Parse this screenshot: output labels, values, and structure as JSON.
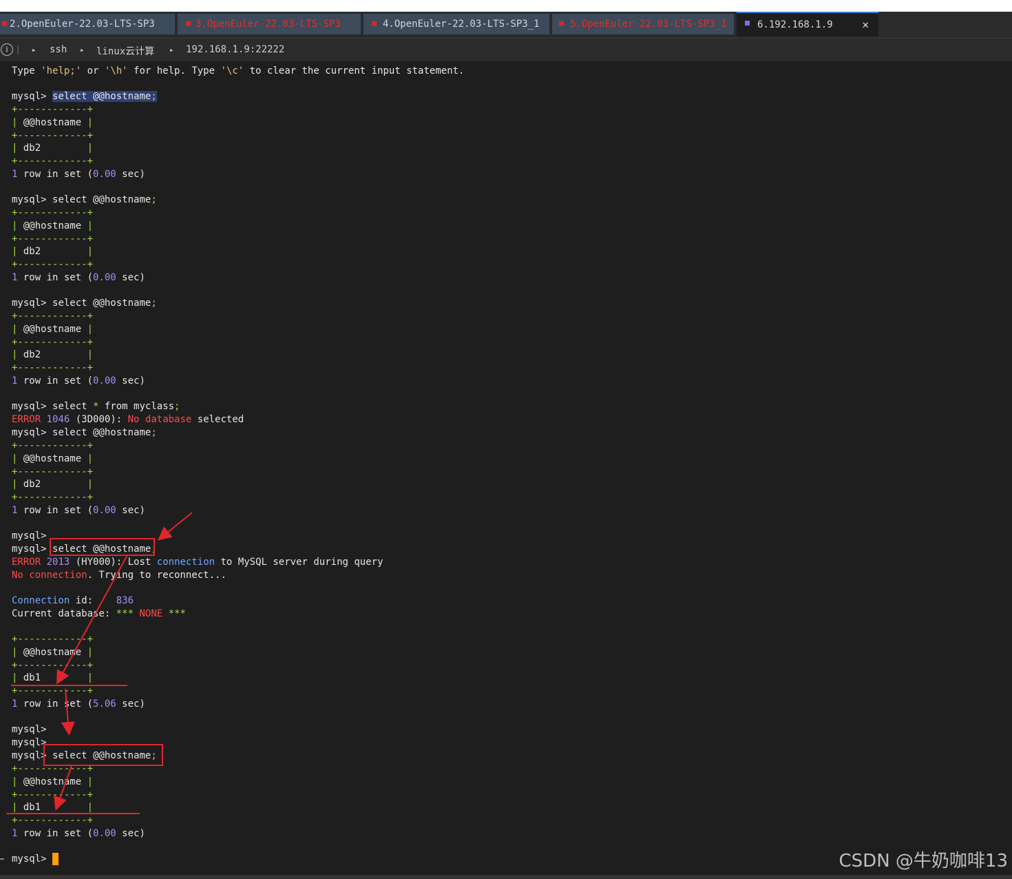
{
  "tabs": [
    {
      "label": "2.OpenEuler-22.03-LTS-SP3",
      "error": false
    },
    {
      "label": "3.OpenEuler-22.03-LTS-SP3",
      "error": true
    },
    {
      "label": "4.OpenEuler-22.03-LTS-SP3_1",
      "error": false
    },
    {
      "label": "5.OpenEuler-22.03-LTS-SP3_1",
      "error": true
    },
    {
      "label": "6.192.168.1.9",
      "error": false,
      "active": true
    }
  ],
  "breadcrumb": {
    "items": [
      "ssh",
      "linux云计算",
      "192.168.1.9:22222"
    ],
    "separator": "▸"
  },
  "terminal": {
    "help": {
      "pre1": "Type ",
      "q1": "'help;'",
      "or": " or ",
      "q2": "'\\h'",
      "mid": " for help. Type ",
      "q3": "'\\c'",
      "end": " to clear the current input statement."
    },
    "prompt": "mysql>",
    "query_hostname": "select @@hostname",
    "semicolon": ";",
    "table_border": "+------------+",
    "table_header": "@@hostname",
    "db2_row": "db2",
    "db1_row": "db1",
    "row_prefix": "1",
    "row_mid": " row in set (",
    "time_000": "0.00",
    "time_506": "5.06",
    "row_suffix": " sec)",
    "query_myclass": {
      "pre": "select ",
      "star": "*",
      "post": " from myclass",
      "semi": ";"
    },
    "error1046": {
      "err": "ERROR",
      "code": "1046",
      "state": "(3D000):",
      "msg1": "No database",
      "msg2": " selected"
    },
    "error2013": {
      "err": "ERROR",
      "code": "2013",
      "state": "(HY000):",
      "msg1": "Lost ",
      "conn": "connection",
      "msg2": " to MySQL server during query"
    },
    "noconn": {
      "a": "No connection",
      "b": ". Trying to reconnect..."
    },
    "connid": {
      "label": "Connection",
      "rest": " id:",
      "value": "836"
    },
    "curdb": {
      "label": "Current database:",
      "stars": "***",
      "none": "NONE"
    }
  },
  "watermark": "CSDN @牛奶咖啡13",
  "colors": {
    "annotation": "#e0262b",
    "cursor": "#ff9f0a",
    "green": "#a3d94a",
    "purple": "#a98bf5",
    "red": "#ff4a4a"
  }
}
